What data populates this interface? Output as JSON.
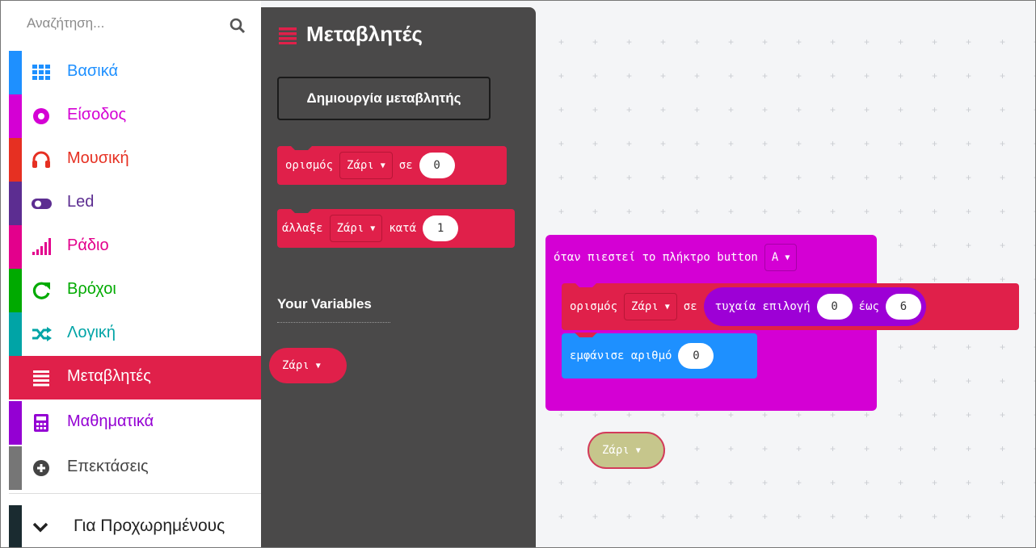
{
  "search": {
    "placeholder": "Αναζήτηση..."
  },
  "categories": [
    {
      "label": "Βασικά",
      "color": "#1e90ff",
      "icon": "grid-icon"
    },
    {
      "label": "Είσοδος",
      "color": "#d400d4",
      "icon": "input-circle-icon"
    },
    {
      "label": "Μουσική",
      "color": "#e63022",
      "icon": "headphones-icon"
    },
    {
      "label": "Led",
      "color": "#5c2d91",
      "icon": "toggle-icon"
    },
    {
      "label": "Ράδιο",
      "color": "#e3008c",
      "icon": "signal-bars-icon"
    },
    {
      "label": "Βρόχοι",
      "color": "#00aa00",
      "icon": "loop-arrow-icon"
    },
    {
      "label": "Λογική",
      "color": "#00a4a6",
      "icon": "shuffle-icon"
    },
    {
      "label": "Μεταβλητές",
      "color": "#e0204a",
      "icon": "list-lines-icon"
    },
    {
      "label": "Μαθηματικά",
      "color": "#9400d3",
      "icon": "calculator-icon"
    },
    {
      "label": "Επεκτάσεις",
      "color": "#767676",
      "icon": "plus-circle-icon"
    }
  ],
  "advanced": {
    "label": "Για Προχωρημένους",
    "icon": "chevron-down-icon"
  },
  "flyout": {
    "title": "Μεταβλητές",
    "create_button": "Δημιουργία μεταβλητής",
    "set_block": {
      "keyword": "ορισμός",
      "variable": "Ζάρι",
      "to": "σε",
      "value": "0"
    },
    "change_block": {
      "keyword": "άλλαξε",
      "variable": "Ζάρι",
      "by": "κατά",
      "value": "1"
    },
    "your_variables": "Your Variables",
    "variable_pill": "Ζάρι"
  },
  "workspace": {
    "event_block": {
      "text": "όταν πιεστεί το πλήκτρο button",
      "button": "A"
    },
    "set_block": {
      "keyword": "ορισμός",
      "variable": "Ζάρι",
      "to": "σε"
    },
    "random_block": {
      "text": "τυχαία επιλογή",
      "from": "0",
      "to_label": "έως",
      "to": "6"
    },
    "show_block": {
      "text": "εμφάνισε αριθμό",
      "value": "0"
    },
    "ghost_variable": "Ζάρι"
  },
  "colors": {
    "variables": "#e0204a",
    "input": "#d400d4",
    "basic": "#1e90ff",
    "math": "#9400d3",
    "flyout_bg": "#4a4949"
  }
}
